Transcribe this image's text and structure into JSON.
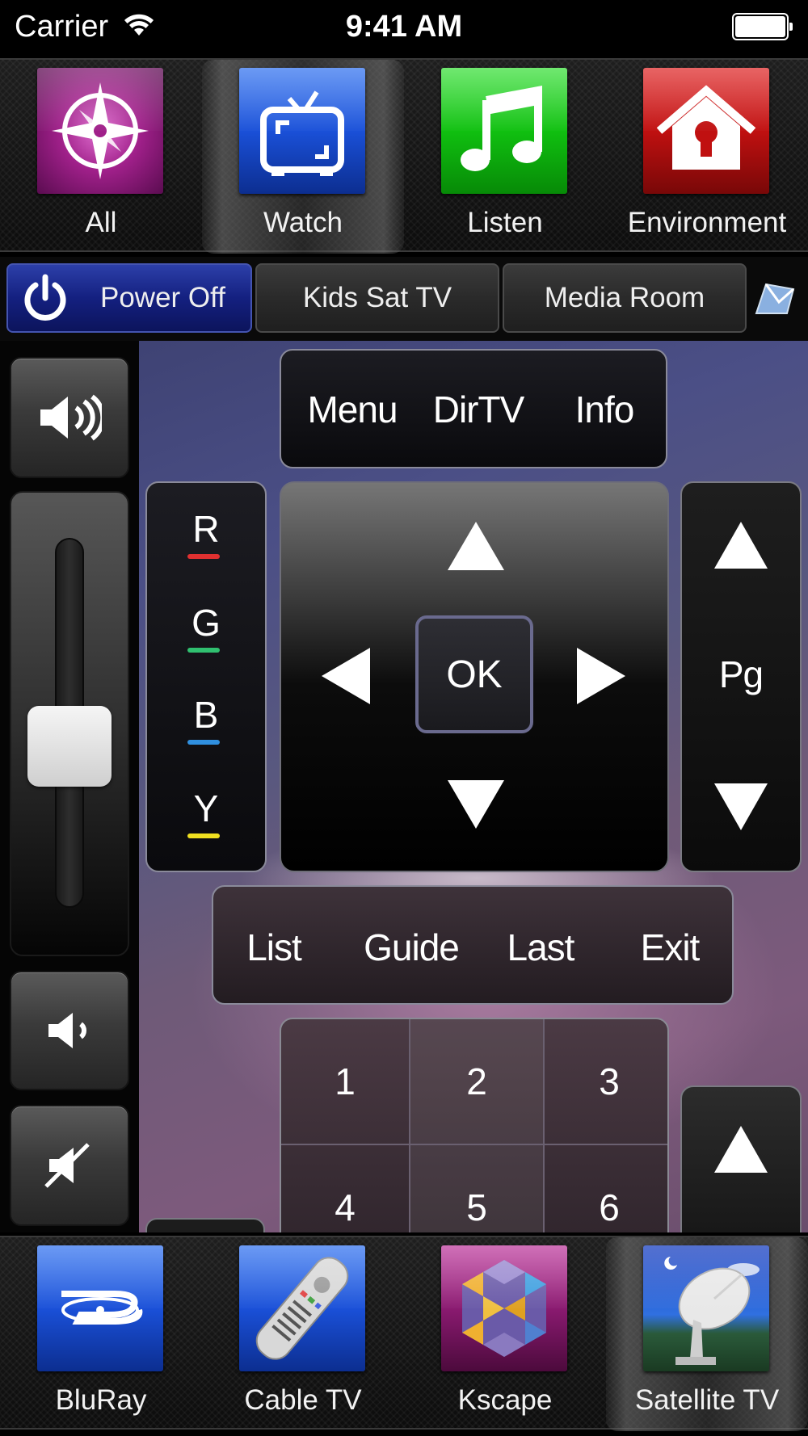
{
  "status_bar": {
    "carrier": "Carrier",
    "time": "9:41 AM",
    "icons": [
      "wifi-icon",
      "battery-icon"
    ]
  },
  "activities": [
    {
      "label": "All",
      "icon": "compass-icon",
      "color": "#a0208a",
      "selected": false
    },
    {
      "label": "Watch",
      "icon": "tv-icon",
      "color": "#1a50d8",
      "selected": true
    },
    {
      "label": "Listen",
      "icon": "music-note-icon",
      "color": "#10c010",
      "selected": false
    },
    {
      "label": "Environment",
      "icon": "house-bulb-icon",
      "color": "#c01010",
      "selected": false
    }
  ],
  "devices": {
    "power_label": "Power Off",
    "room_1": "Kids Sat TV",
    "room_2": "Media Room",
    "extra_icon": "flag-icon"
  },
  "top_panel": {
    "menu": "Menu",
    "dirtv": "DirTV",
    "info": "Info"
  },
  "color_buttons": [
    {
      "label": "R",
      "color": "#e03030"
    },
    {
      "label": "G",
      "color": "#30c070"
    },
    {
      "label": "B",
      "color": "#3090e0"
    },
    {
      "label": "Y",
      "color": "#f0e020"
    }
  ],
  "dpad": {
    "ok": "OK"
  },
  "page": {
    "label": "Pg"
  },
  "guide_panel": {
    "list": "List",
    "guide": "Guide",
    "last": "Last",
    "exit": "Exit"
  },
  "numpad": [
    "1",
    "2",
    "3",
    "4",
    "5",
    "6"
  ],
  "volume": {
    "level": 0.42
  },
  "sources": [
    {
      "label": "BluRay",
      "icon": "bluray-icon",
      "color": "#1a50d8",
      "selected": false
    },
    {
      "label": "Cable TV",
      "icon": "remote-control-icon",
      "color": "#1a50d8",
      "selected": false
    },
    {
      "label": "Kscape",
      "icon": "kscape-logo-icon",
      "color": "#8a1a70",
      "selected": false
    },
    {
      "label": "Satellite TV",
      "icon": "satellite-dish-icon",
      "color": "#1a50d8",
      "selected": true
    }
  ]
}
